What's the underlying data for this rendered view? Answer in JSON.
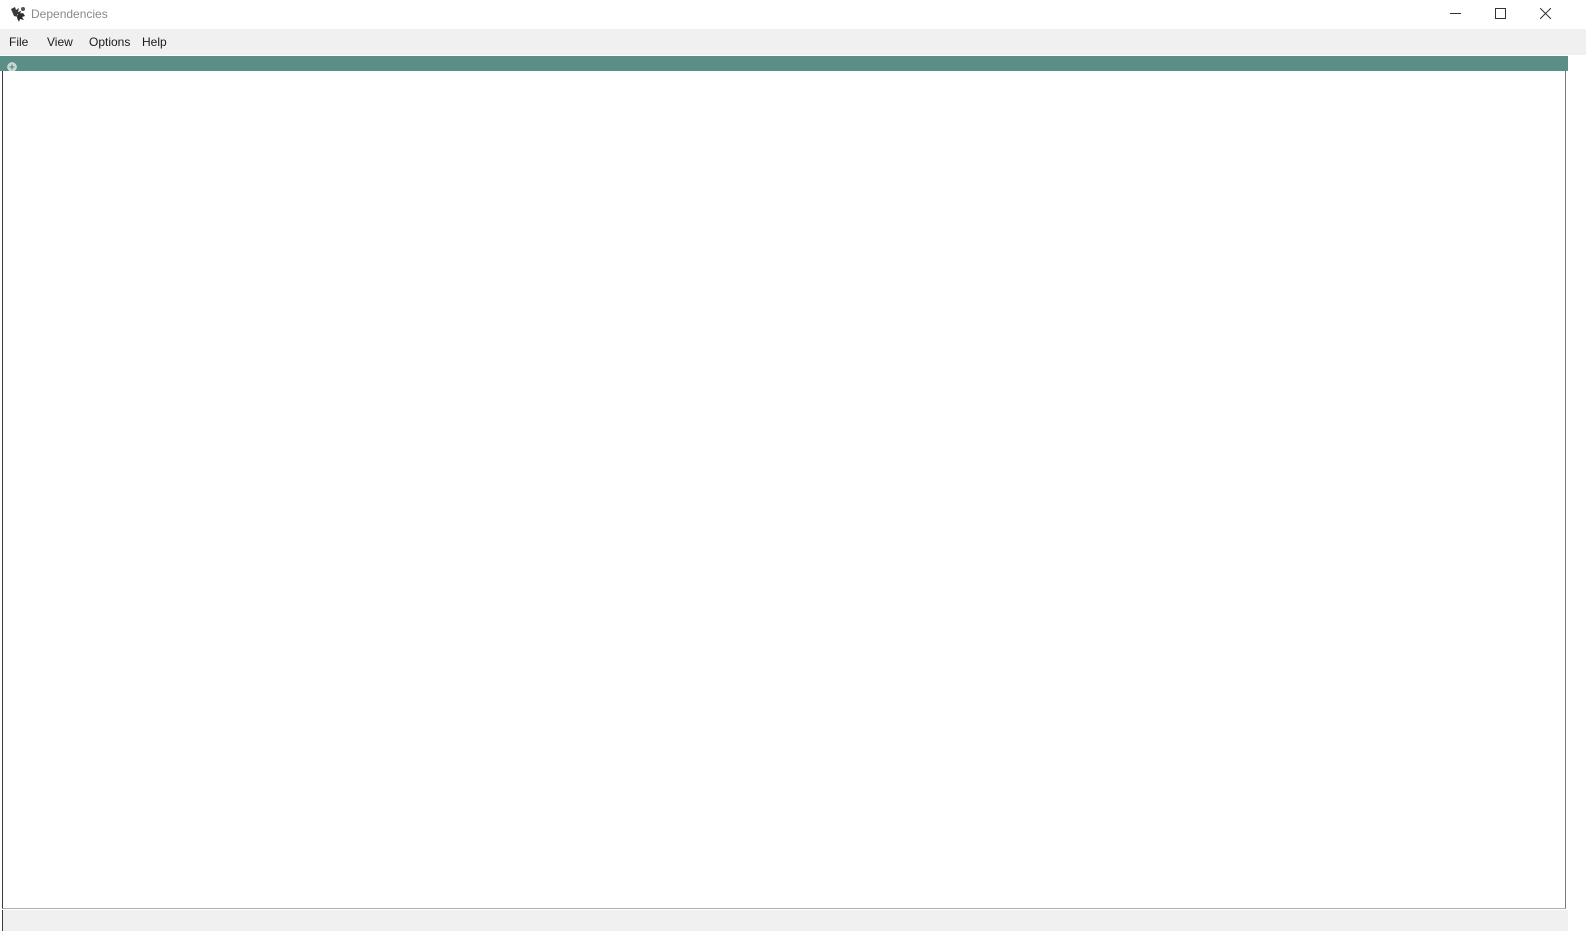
{
  "window": {
    "title": "Dependencies",
    "icon": "dependencies-app-icon"
  },
  "caption_buttons": {
    "minimize_icon": "minimize-icon",
    "maximize_icon": "maximize-icon",
    "close_icon": "close-icon"
  },
  "menu": {
    "items": [
      {
        "label": "File"
      },
      {
        "label": "View"
      },
      {
        "label": "Options"
      },
      {
        "label": "Help"
      }
    ]
  },
  "tab_strip": {
    "color": "#5b8e86",
    "add_icon": "add-tab-icon"
  },
  "colors": {
    "menubar_bg": "#f0f0f0",
    "title_text": "#8a8a8a",
    "accent": "#5b8e86"
  }
}
